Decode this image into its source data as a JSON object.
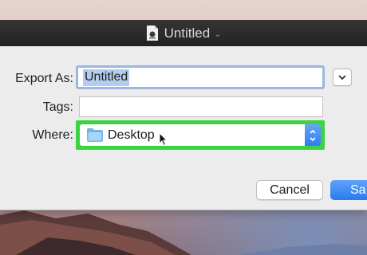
{
  "window": {
    "title": "Untitled",
    "title_icon": "document-icon",
    "title_menu_icon": "chevron-down-icon"
  },
  "dialog": {
    "export_as_label": "Export As:",
    "export_as_value": "Untitled",
    "tags_label": "Tags:",
    "tags_value": "",
    "where_label": "Where:",
    "where_value": "Desktop",
    "where_icon": "folder-icon",
    "expand_icon": "chevron-down-icon",
    "cancel_label": "Cancel",
    "save_label": "Sa"
  },
  "colors": {
    "highlight": "#3bd33f",
    "accent": "#2d7cf0",
    "selection": "#b4cdef"
  }
}
